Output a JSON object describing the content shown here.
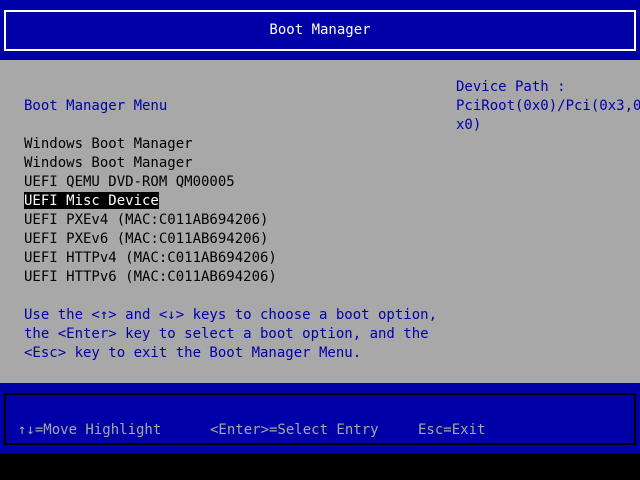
{
  "header": {
    "title": "Boot Manager"
  },
  "menu": {
    "heading": "Boot Manager Menu",
    "entries": [
      {
        "label": "Windows Boot Manager",
        "selected": false
      },
      {
        "label": "Windows Boot Manager",
        "selected": false
      },
      {
        "label": "UEFI QEMU DVD-ROM QM00005",
        "selected": false
      },
      {
        "label": "UEFI Misc Device",
        "selected": true
      },
      {
        "label": "UEFI PXEv4 (MAC:C011AB694206)",
        "selected": false
      },
      {
        "label": "UEFI PXEv6 (MAC:C011AB694206)",
        "selected": false
      },
      {
        "label": "UEFI HTTPv4 (MAC:C011AB694206)",
        "selected": false
      },
      {
        "label": "UEFI HTTPv6 (MAC:C011AB694206)",
        "selected": false
      }
    ]
  },
  "help": {
    "lines": [
      "Use the <↑> and <↓> keys to choose a boot option,",
      "the <Enter> key to select a boot option, and the",
      "<Esc> key to exit the Boot Manager Menu."
    ]
  },
  "device_path": {
    "lines": [
      "Device Path :",
      "PciRoot(0x0)/Pci(0x3,0",
      "x0)"
    ]
  },
  "footer": {
    "move_hint": "↑↓=Move Highlight",
    "select_hint": "<Enter>=Select Entry",
    "exit_hint": "Esc=Exit"
  },
  "colors": {
    "band_blue": "#0000a8",
    "main_gray": "#a8a8a8",
    "text_blue": "#0000a8",
    "highlight_bg": "#000000",
    "highlight_fg": "#ffffff"
  }
}
